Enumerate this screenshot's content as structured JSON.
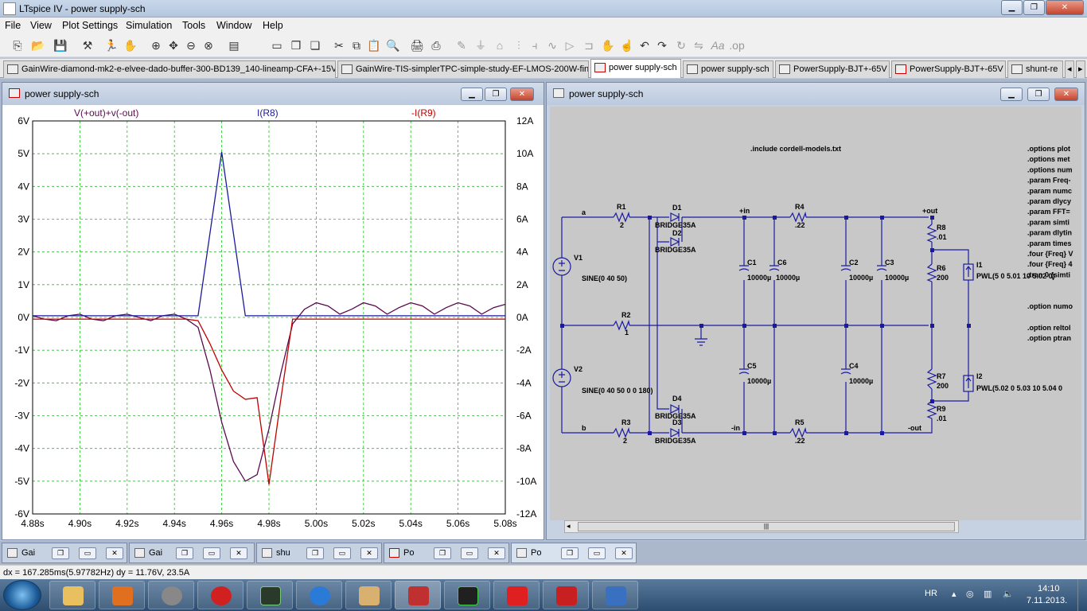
{
  "app": {
    "title": "LTspice IV - power supply-sch"
  },
  "menu": [
    "File",
    "View",
    "Plot Settings",
    "Simulation",
    "Tools",
    "Window",
    "Help"
  ],
  "tabs": [
    {
      "label": "GainWire-diamond-mk2-e-elvee-dado-buffer-300-BD139_140-lineamp-CFA+-15V-c",
      "type": "schematic"
    },
    {
      "label": "GainWire-TIS-simplerTPC-simple-study-EF-LMOS-200W-final",
      "type": "schematic"
    },
    {
      "label": "power supply-sch",
      "type": "plot",
      "active": true
    },
    {
      "label": "power supply-sch",
      "type": "schematic"
    },
    {
      "label": "PowerSupply-BJT+-65V",
      "type": "schematic"
    },
    {
      "label": "PowerSupply-BJT+-65V",
      "type": "plot"
    },
    {
      "label": "shunt-re",
      "type": "schematic"
    }
  ],
  "plot_window": {
    "title": "power supply-sch",
    "trace_labels": [
      {
        "text": "V(+out)+v(-out)",
        "color": "#5a0a50"
      },
      {
        "text": "I(R8)",
        "color": "#1a1aa0"
      },
      {
        "text": "-I(R9)",
        "color": "#c00000"
      }
    ]
  },
  "chart_data": {
    "type": "line",
    "x_ticks": [
      "4.88s",
      "4.90s",
      "4.92s",
      "4.94s",
      "4.96s",
      "4.98s",
      "5.00s",
      "5.02s",
      "5.04s",
      "5.06s",
      "5.08s"
    ],
    "y_left_ticks": [
      "6V",
      "5V",
      "4V",
      "3V",
      "2V",
      "1V",
      "0V",
      "-1V",
      "-2V",
      "-3V",
      "-4V",
      "-5V",
      "-6V"
    ],
    "y_right_ticks": [
      "12A",
      "10A",
      "8A",
      "6A",
      "4A",
      "2A",
      "0A",
      "-2A",
      "-4A",
      "-6A",
      "-8A",
      "-10A",
      "-12A"
    ],
    "xlim": [
      4.88,
      5.08
    ],
    "ylim_left": [
      -6,
      6
    ],
    "ylim_right": [
      -12,
      12
    ],
    "grid": true,
    "series": [
      {
        "name": "V(+out)+v(-out)",
        "color": "#5a0a50",
        "axis": "left",
        "x": [
          4.88,
          4.885,
          4.89,
          4.895,
          4.9,
          4.905,
          4.91,
          4.915,
          4.92,
          4.925,
          4.93,
          4.935,
          4.94,
          4.945,
          4.95,
          4.955,
          4.96,
          4.965,
          4.97,
          4.975,
          4.98,
          4.985,
          4.99,
          4.995,
          5.0,
          5.005,
          5.01,
          5.015,
          5.02,
          5.025,
          5.03,
          5.035,
          5.04,
          5.045,
          5.05,
          5.055,
          5.06,
          5.065,
          5.07,
          5.075,
          5.08
        ],
        "y": [
          0.05,
          -0.05,
          -0.1,
          0.05,
          0.1,
          -0.05,
          -0.1,
          0.05,
          0.1,
          0.0,
          -0.1,
          0.05,
          0.1,
          -0.05,
          -0.3,
          -1.6,
          -3.2,
          -4.4,
          -5.0,
          -4.8,
          -3.4,
          -1.7,
          -0.2,
          0.25,
          0.45,
          0.35,
          0.1,
          0.25,
          0.45,
          0.35,
          0.1,
          0.3,
          0.45,
          0.35,
          0.1,
          0.3,
          0.45,
          0.35,
          0.1,
          0.3,
          0.4
        ]
      },
      {
        "name": "I(R8)",
        "color": "#1a1aa0",
        "axis": "right",
        "x": [
          4.88,
          4.95,
          4.96,
          4.97,
          4.98,
          5.0,
          5.08
        ],
        "y": [
          0.1,
          0.1,
          10.1,
          0.1,
          0.1,
          0.1,
          0.1
        ]
      },
      {
        "name": "-I(R9)",
        "color": "#c00000",
        "axis": "right",
        "x": [
          4.88,
          4.945,
          4.95,
          4.955,
          4.96,
          4.965,
          4.97,
          4.975,
          4.98,
          4.985,
          4.99,
          5.0,
          5.08
        ],
        "y": [
          -0.1,
          -0.1,
          -0.2,
          -1.6,
          -3.2,
          -4.5,
          -5.0,
          -4.9,
          -10.2,
          -5.0,
          -0.1,
          -0.1,
          -0.1
        ]
      }
    ]
  },
  "schematic_window": {
    "title": "power supply-sch",
    "directive_include": ".include cordell-models.txt",
    "directives": [
      ".options plot",
      ".options met",
      ".options num",
      ".param Freq-",
      ".param numc",
      ".param dlycy",
      ".param FFT=",
      ".param simti",
      ".param dlytin",
      ".param times",
      ".four {Freq} V",
      ".four {Freq} 4",
      ".tran 0 {simti"
    ],
    "directives2": [
      ".option numo"
    ],
    "directives3": [
      ".option reltol",
      ".option ptran"
    ],
    "nets": {
      "a": "a",
      "b": "b",
      "in_pos": "+in",
      "in_neg": "-in",
      "out_pos": "+out",
      "out_neg": "-out"
    },
    "components": [
      {
        "ref": "R1",
        "value": "2"
      },
      {
        "ref": "R2",
        "value": "1"
      },
      {
        "ref": "R3",
        "value": "2"
      },
      {
        "ref": "R4",
        "value": ".22"
      },
      {
        "ref": "R5",
        "value": ".22"
      },
      {
        "ref": "R6",
        "value": "200"
      },
      {
        "ref": "R7",
        "value": "200"
      },
      {
        "ref": "R8",
        "value": ".01"
      },
      {
        "ref": "R9",
        "value": ".01"
      },
      {
        "ref": "D1",
        "value": "BRIDGE35A"
      },
      {
        "ref": "D2",
        "value": "BRIDGE35A"
      },
      {
        "ref": "D3",
        "value": "BRIDGE35A"
      },
      {
        "ref": "D4",
        "value": "BRIDGE35A"
      },
      {
        "ref": "C1",
        "value": "10000µ"
      },
      {
        "ref": "C2",
        "value": "10000µ"
      },
      {
        "ref": "C3",
        "value": "10000µ"
      },
      {
        "ref": "C4",
        "value": "10000µ"
      },
      {
        "ref": "C5",
        "value": "10000µ"
      },
      {
        "ref": "C6",
        "value": "10000µ"
      },
      {
        "ref": "V1",
        "value": "SINE(0 40 50)"
      },
      {
        "ref": "V2",
        "value": "SINE(0 40 50 0 0 180)"
      },
      {
        "ref": "I1",
        "value": "PWL(5 0 5.01 10 5.02 0)"
      },
      {
        "ref": "I2",
        "value": "PWL(5.02 0 5.03 10 5.04 0"
      }
    ]
  },
  "minimized_windows": [
    {
      "label": "Gai"
    },
    {
      "label": "Gai"
    },
    {
      "label": "shu"
    },
    {
      "label": "Po"
    },
    {
      "label": "Po"
    }
  ],
  "status_text": "dx = 167.285ms(5.97782Hz)   dy = 11.76V, 23.5A",
  "taskbar": {
    "lang": "HR",
    "time": "14:10",
    "date": "7.11.2013."
  }
}
